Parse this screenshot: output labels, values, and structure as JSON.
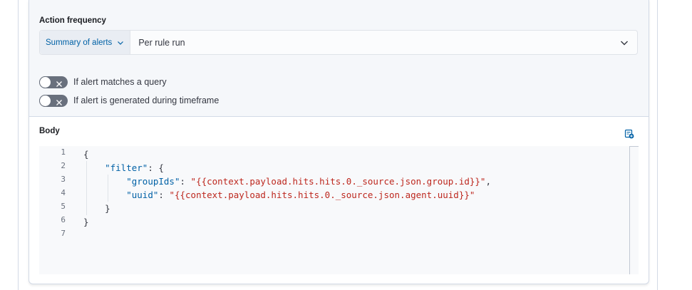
{
  "action_frequency": {
    "label": "Action frequency",
    "summary_button": "Summary of alerts",
    "selected": "Per rule run"
  },
  "toggles": [
    {
      "label": "If alert matches a query",
      "on": false
    },
    {
      "label": "If alert is generated during timeframe",
      "on": false
    }
  ],
  "body": {
    "label": "Body",
    "line_numbers": [
      "1",
      "2",
      "3",
      "4",
      "5",
      "6",
      "7"
    ],
    "lines": [
      {
        "indent": "",
        "key": "",
        "sep": "",
        "value": "",
        "rest": "{"
      },
      {
        "indent": "    ",
        "key": "\"filter\"",
        "sep": ": ",
        "value": "",
        "rest": "{"
      },
      {
        "indent": "        ",
        "key": "\"groupIds\"",
        "sep": ": ",
        "value": "\"{{context.payload.hits.hits.0._source.json.group.id}}\"",
        "rest": ","
      },
      {
        "indent": "        ",
        "key": "\"uuid\"",
        "sep": ": ",
        "value": "\"{{context.payload.hits.hits.0._source.json.agent.uuid}}\"",
        "rest": ""
      },
      {
        "indent": "    ",
        "key": "",
        "sep": "",
        "value": "",
        "rest": "}"
      },
      {
        "indent": "",
        "key": "",
        "sep": "",
        "value": "",
        "rest": "}"
      },
      {
        "indent": "",
        "key": "",
        "sep": "",
        "value": "",
        "rest": ""
      }
    ]
  },
  "colors": {
    "accent": "#0061a6",
    "string": "#bd271e",
    "toggle_off": "#69707d"
  },
  "icons": {
    "summary_chevron": "chevron-down-icon",
    "select_chevron": "chevron-down-icon",
    "toggle_x": "cross-icon",
    "add_variable": "add-variable-icon"
  }
}
